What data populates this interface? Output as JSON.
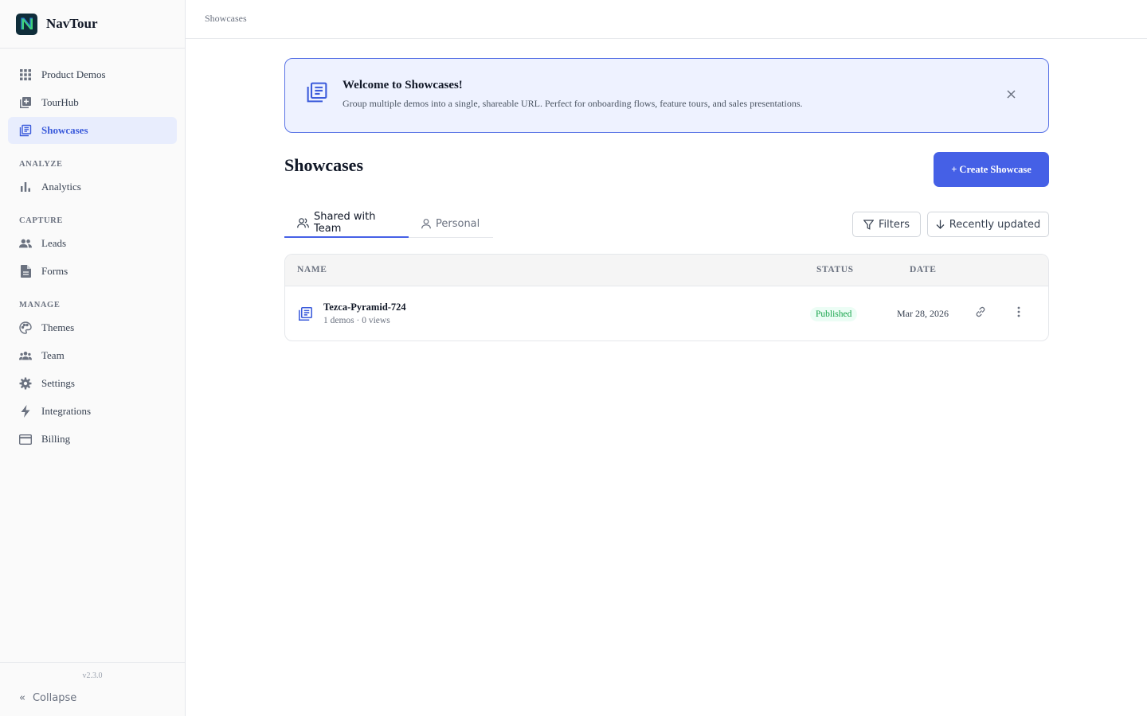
{
  "app": {
    "name": "NavTour",
    "version": "v2.3.0"
  },
  "colors": {
    "accent": "#4560e6",
    "active_bg": "#e8edfd",
    "banner_bg": "#eef2ff",
    "published": "#16a34a"
  },
  "sidebar": {
    "items_top": [
      {
        "label": "Product Demos",
        "icon": "grid-icon"
      },
      {
        "label": "TourHub",
        "icon": "tourhub-icon"
      },
      {
        "label": "Showcases",
        "icon": "showcases-icon",
        "active": true
      }
    ],
    "sections": [
      {
        "label": "ANALYZE",
        "items": [
          {
            "label": "Analytics",
            "icon": "bar-chart-icon"
          }
        ]
      },
      {
        "label": "CAPTURE",
        "items": [
          {
            "label": "Leads",
            "icon": "people-icon"
          },
          {
            "label": "Forms",
            "icon": "document-icon"
          }
        ]
      },
      {
        "label": "MANAGE",
        "items": [
          {
            "label": "Themes",
            "icon": "palette-icon"
          },
          {
            "label": "Team",
            "icon": "team-icon"
          },
          {
            "label": "Settings",
            "icon": "gear-icon"
          },
          {
            "label": "Integrations",
            "icon": "bolt-icon"
          },
          {
            "label": "Billing",
            "icon": "credit-card-icon"
          }
        ]
      }
    ],
    "collapse_label": "Collapse"
  },
  "topbar": {
    "breadcrumb": "Showcases"
  },
  "banner": {
    "title": "Welcome to Showcases!",
    "text": "Group multiple demos into a single, shareable URL. Perfect for onboarding flows, feature tours, and sales presentations."
  },
  "page": {
    "title": "Showcases",
    "create_label": "+ Create Showcase"
  },
  "tabs": [
    {
      "label": "Shared with Team",
      "active": true
    },
    {
      "label": "Personal",
      "active": false
    }
  ],
  "toolbar": {
    "filters_label": "Filters",
    "sort_label": "Recently updated"
  },
  "table": {
    "columns": [
      "NAME",
      "STATUS",
      "DATE"
    ],
    "rows": [
      {
        "title": "Tezca-Pyramid-724",
        "subtitle": "1 demos · 0 views",
        "status": "Published",
        "date": "Mar 28, 2026"
      }
    ]
  }
}
